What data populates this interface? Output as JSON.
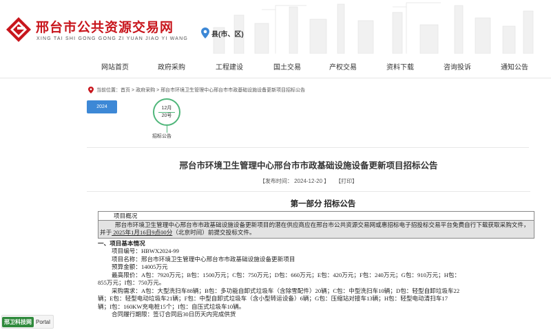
{
  "site": {
    "title": "邢台市公共资源交易网",
    "subtitle": "XING TAI SHI GONG GONG ZI YUAN JIAO YI WANG",
    "region_label": "县(市、区)",
    "brand_color": "#c8161d"
  },
  "nav": {
    "items": [
      "网站首页",
      "政府采购",
      "工程建设",
      "国土交易",
      "产权交易",
      "资料下载",
      "咨询投诉",
      "通知公告"
    ]
  },
  "breadcrumb": {
    "prefix": "当前位置：",
    "items": [
      "首页",
      "政府采购",
      "邢台市环境卫生管理中心邢台市市政基础设施设备更新项目招标公告"
    ],
    "separator": ">"
  },
  "timeline": {
    "year": "2024",
    "month": "12月",
    "day": "20号",
    "tag": "招标公告",
    "accent": "#4fb67a",
    "year_tab_color": "#3d88d6"
  },
  "article": {
    "title": "邢台市环境卫生管理中心邢台市市政基础设施设备更新项目招标公告",
    "publish_label": "【发布时间：",
    "publish_date": "2024-12-20",
    "publish_close": "】",
    "print_label": "【打印】",
    "part_heading": "第一部分  招标公告",
    "overview_head": "项目概况",
    "overview_text_1": "邢台市环境卫生管理中心邢台市市政基础设施设备更新项目的潜在供应商应在邢台市公共资源交易网或惠招标电子招投标交易平台免费自行下载获取采购文件，并于",
    "overview_deadline": " 2025年1月16日9点00分",
    "overview_text_2": "（北京时间）前提交投标文件。",
    "section1_title": "一、项目基本情况",
    "rows": [
      "项目编号：HBWX2024-99",
      "项目名称：邢台市环境卫生管理中心邢台市市政基础设施设备更新项目",
      "预算金额：14005万元",
      "最高限价：A包：7920万元；B包：1500万元；C包：750万元；D包：660万元；E包：420万元；F包：240万元；G包：910万元；H包：",
      "855万元；I包：750万元。",
      "采购需求：A包：大型洗扫车88辆；B包：多功能自卸式垃圾车（含除雪配件）20辆；C包：中型洗扫车10辆；D包：轻型自卸垃圾车22",
      "辆；E包：轻型电动垃圾车21辆；F包：中型自卸式垃圾车（含小型转运设备）6辆；G包：压缩站对接车13辆；H包：轻型电动清扫车17",
      "辆；I包：160KW充电桩15个；I包：自压式垃圾车10辆。",
      "合同履行期限：签订合同后30日历天内完成供货"
    ]
  },
  "badge": {
    "logo_text": "邢卫科技网",
    "text": "Portal"
  }
}
